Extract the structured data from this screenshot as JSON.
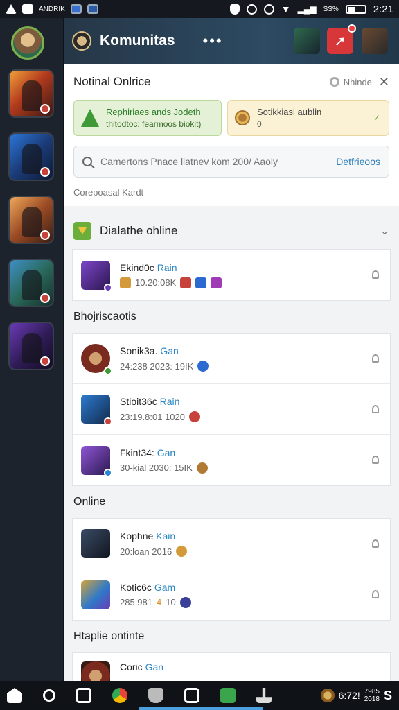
{
  "statusbar": {
    "app_text": "ANDRIK",
    "signal_text": "SS%",
    "time": "2:21"
  },
  "header": {
    "title": "Komunitas",
    "more": "•••"
  },
  "notice": {
    "title": "Notinal Onlrice",
    "right_label": "Nhinde",
    "close": "✕",
    "card_green": {
      "line1": "Rephiriaes ands Jodeth",
      "line2": "thitodtoc: fearmoos biokit)"
    },
    "card_yellow": {
      "line1": "Sotikkiasl aublin",
      "line2": "0"
    },
    "search_placeholder": "Camertons Pnace llatnev kom 200/ Aaoly",
    "search_link": "Detfrieoos",
    "footer": "Corepoasal Kardt"
  },
  "sections": {
    "main_label": "Dialathe ohline",
    "chevron": "⌄",
    "s2_label": "Bhojriscaotis",
    "s3_label": "Online",
    "s4_label": "Htaplie ontinte"
  },
  "rows": {
    "r1": {
      "name": "Ekind0c",
      "tag": "Rain",
      "meta": "10.20:08K"
    },
    "r2": {
      "name": "Sonik3a.",
      "tag": "Gan",
      "meta": "24:238 2023: 19IK"
    },
    "r3": {
      "name": "Stioit36c",
      "tag": "Rain",
      "meta": "23:19.8:01 1020"
    },
    "r4": {
      "name": "Fkint34:",
      "tag": "Gan",
      "meta": "30-kial 2030: 15IK"
    },
    "r5": {
      "name": "Kophne",
      "tag": "Kain",
      "meta": "20:loan 2016"
    },
    "r6": {
      "name": "Kotic6c",
      "tag": "Gam",
      "meta": "285.981",
      "meta_accent": "4",
      "meta_tail": "10"
    },
    "r7": {
      "name": "Coric",
      "tag": "Gan"
    }
  },
  "taskbar": {
    "clock": "6:72!",
    "date_top": "7985",
    "date_bottom": "2018",
    "end_label": "S"
  },
  "colors": {
    "accent": "#2a86c4",
    "header_bg": "#2c4a62",
    "success": "#3e9a37"
  }
}
